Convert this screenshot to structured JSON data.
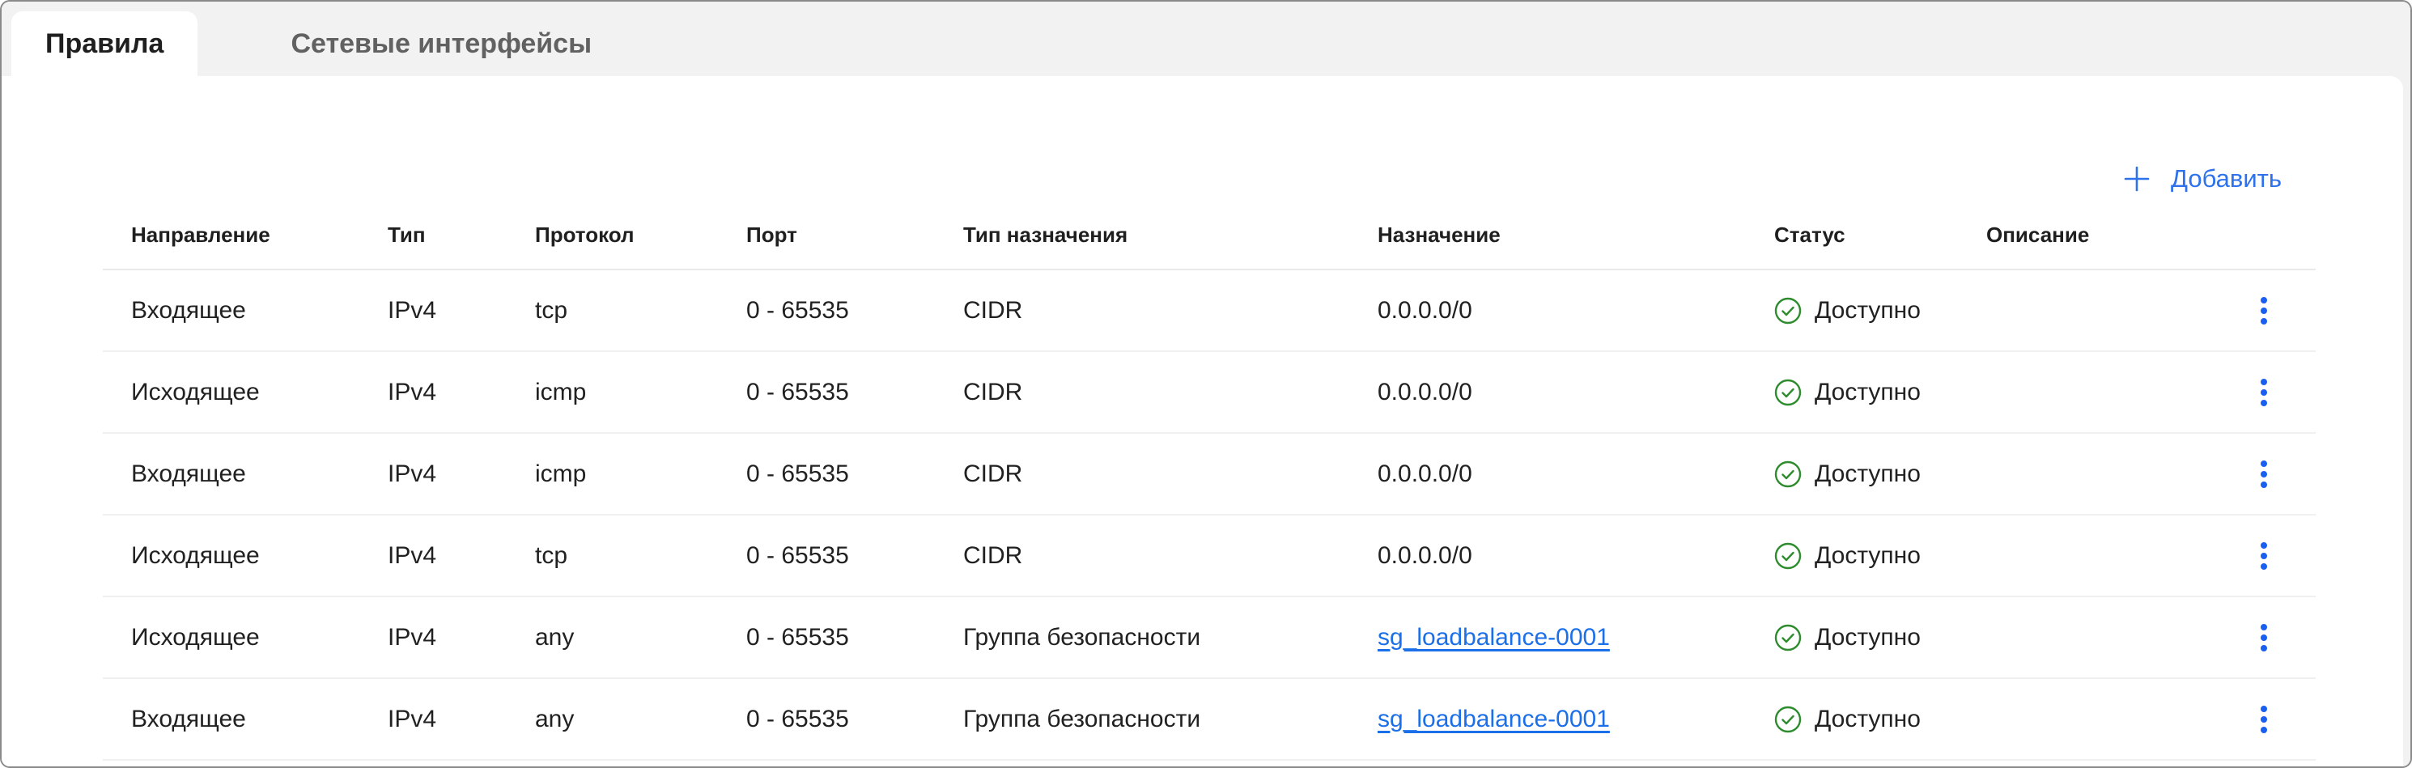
{
  "tabs": [
    {
      "label": "Правила",
      "active": true
    },
    {
      "label": "Сетевые интерфейсы",
      "active": false
    }
  ],
  "toolbar": {
    "add_label": "Добавить"
  },
  "table": {
    "columns": [
      "Направление",
      "Тип",
      "Протокол",
      "Порт",
      "Тип назначения",
      "Назначение",
      "Статус",
      "Описание"
    ],
    "rows": [
      {
        "direction": "Входящее",
        "type": "IPv4",
        "protocol": "tcp",
        "port": "0 - 65535",
        "dest_type": "CIDR",
        "destination": "0.0.0.0/0",
        "destination_is_link": false,
        "status": "Доступно",
        "description": ""
      },
      {
        "direction": "Исходящее",
        "type": "IPv4",
        "protocol": "icmp",
        "port": "0 - 65535",
        "dest_type": "CIDR",
        "destination": "0.0.0.0/0",
        "destination_is_link": false,
        "status": "Доступно",
        "description": ""
      },
      {
        "direction": "Входящее",
        "type": "IPv4",
        "protocol": "icmp",
        "port": "0 - 65535",
        "dest_type": "CIDR",
        "destination": "0.0.0.0/0",
        "destination_is_link": false,
        "status": "Доступно",
        "description": ""
      },
      {
        "direction": "Исходящее",
        "type": "IPv4",
        "protocol": "tcp",
        "port": "0 - 65535",
        "dest_type": "CIDR",
        "destination": "0.0.0.0/0",
        "destination_is_link": false,
        "status": "Доступно",
        "description": ""
      },
      {
        "direction": "Исходящее",
        "type": "IPv4",
        "protocol": "any",
        "port": "0 - 65535",
        "dest_type": "Группа безопасности",
        "destination": "sg_loadbalance-0001",
        "destination_is_link": true,
        "status": "Доступно",
        "description": ""
      },
      {
        "direction": "Входящее",
        "type": "IPv4",
        "protocol": "any",
        "port": "0 - 65535",
        "dest_type": "Группа безопасности",
        "destination": "sg_loadbalance-0001",
        "destination_is_link": true,
        "status": "Доступно",
        "description": ""
      }
    ]
  },
  "colors": {
    "accent_blue": "#2d72ec",
    "link_blue": "#1b6fe8",
    "kebab_blue": "#1a5ff0",
    "status_green": "#2e8c2e",
    "tabbar_gray": "#f2f2f2"
  }
}
